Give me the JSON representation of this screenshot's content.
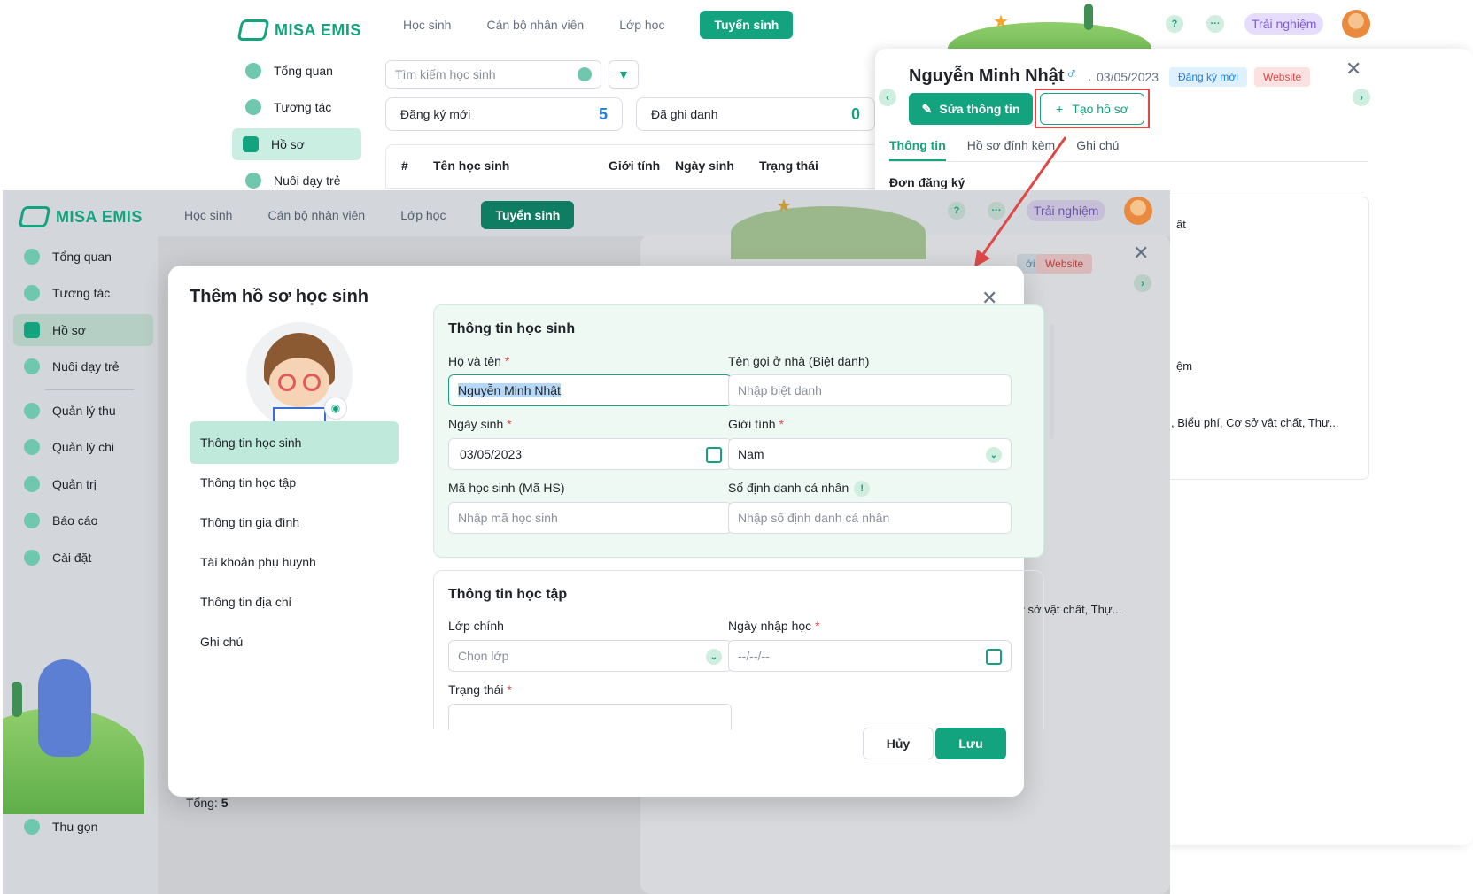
{
  "brand": "MISA EMIS",
  "back": {
    "nav_tabs": [
      "Học sinh",
      "Cán bộ nhân viên",
      "Lớp học",
      "Tuyển sinh"
    ],
    "sidebar": [
      "Tổng quan",
      "Tương tác",
      "Hồ sơ",
      "Nuôi dạy trẻ"
    ],
    "help": "?",
    "more": "···",
    "trial": "Trải nghiệm",
    "search_placeholder": "Tìm kiếm học sinh",
    "stats": [
      {
        "label": "Đăng ký mới",
        "value": "5"
      },
      {
        "label": "Đã ghi danh",
        "value": "0"
      }
    ],
    "columns": [
      "#",
      "Tên học sinh",
      "Giới tính",
      "Ngày sinh",
      "Trạng thái"
    ]
  },
  "detail": {
    "name": "Nguyễn Minh Nhật",
    "gender_symbol": "♂",
    "dot": "·",
    "dob": "03/05/2023",
    "badge_new": "Đăng ký mới",
    "badge_web": "Website",
    "edit_btn": "Sửa thông tin",
    "create_btn": "Tạo hồ sơ",
    "plus": "+",
    "tabs": [
      "Thông tin",
      "Hồ sơ đính kèm",
      "Ghi chú"
    ],
    "section": "Đơn đăng ký",
    "frag1": "ất",
    "frag2": "ệm",
    "frag3": ", Biểu phí, Cơ sở vật chất, Thự...",
    "nav_prev": "‹",
    "nav_next": "›",
    "close": "✕"
  },
  "front": {
    "nav_tabs": [
      "Học sinh",
      "Cán bộ nhân viên",
      "Lớp học",
      "Tuyển sinh"
    ],
    "sidebar": [
      "Tổng quan",
      "Tương tác",
      "Hồ sơ",
      "Nuôi dạy trẻ",
      "Quản lý thu",
      "Quản lý chi",
      "Quản trị",
      "Báo cáo",
      "Cài đặt"
    ],
    "collapse": "Thu gọn",
    "total_label": "Tổng:",
    "total_value": "5",
    "badge_frag": "ới",
    "badge_web": "Website",
    "frag": "Cơ sở vật chất, Thự...",
    "trial": "Trải nghiệm"
  },
  "modal": {
    "title": "Thêm hồ sơ học sinh",
    "close": "✕",
    "nav": [
      "Thông tin học sinh",
      "Thông tin học tập",
      "Thông tin gia đình",
      "Tài khoản phụ huynh",
      "Thông tin địa chỉ",
      "Ghi chú"
    ],
    "section1": {
      "title": "Thông tin học sinh",
      "fullname_label": "Họ và tên",
      "fullname_value": "Nguyễn Minh Nhật",
      "nickname_label": "Tên gọi ở nhà (Biệt danh)",
      "nickname_ph": "Nhập biệt danh",
      "dob_label": "Ngày sinh",
      "dob_value": "03/05/2023",
      "gender_label": "Giới tính",
      "gender_value": "Nam",
      "code_label": "Mã học sinh (Mã HS)",
      "code_ph": "Nhập mã học sinh",
      "id_label": "Số định danh cá nhân",
      "id_ph": "Nhập số định danh cá nhân",
      "info": "!"
    },
    "section2": {
      "title": "Thông tin học tập",
      "class_label": "Lớp chính",
      "class_ph": "Chọn lớp",
      "enroll_label": "Ngày nhập học",
      "enroll_ph": "--/--/--",
      "status_label": "Trạng thái"
    },
    "required": "*",
    "cancel": "Hủy",
    "save": "Lưu"
  },
  "colors": {
    "accent": "#14a37f",
    "annotation": "#e04848"
  }
}
